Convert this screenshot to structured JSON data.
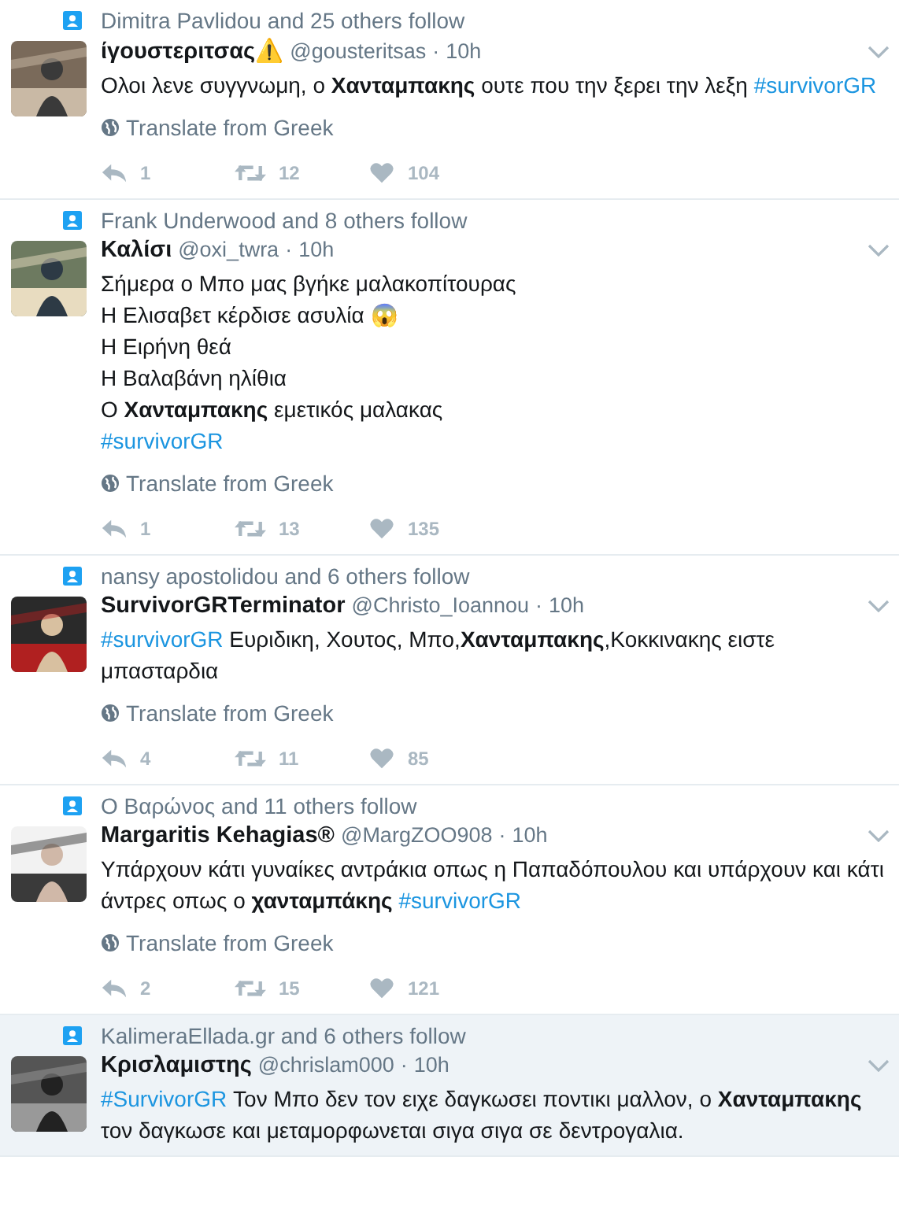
{
  "tweets": [
    {
      "social_context": "Dimitra Pavlidou and 25 others follow",
      "name": "ίγουστεριτσας⚠️",
      "handle": "@gousteritsas",
      "separator": "·",
      "time": "10h",
      "highlighted": false,
      "body": [
        {
          "kind": "text",
          "text": "Ολοι λενε συγγνωμη, ο **Χανταμπακης** ουτε που την ξερει την λεξη "
        },
        {
          "kind": "hashtag",
          "text": "#survivorGR"
        }
      ],
      "translate": "Translate from Greek",
      "replies": "1",
      "retweets": "12",
      "likes": "104"
    },
    {
      "social_context": "Frank Underwood and 8 others follow",
      "name": "Καλίσι",
      "handle": "@oxi_twra",
      "separator": "·",
      "time": "10h",
      "highlighted": false,
      "body": [
        {
          "kind": "text",
          "text": "Σήμερα ο Μπο μας βγήκε μαλακοπίτουρας\nΗ Ελισαβετ κέρδισε ασυλία 😱\nΗ Ειρήνη θεά\nΗ Βαλαβάνη ηλίθια\nΟ **Χανταμπακης** εμετικός μαλακας\n "
        },
        {
          "kind": "hashtag",
          "text": "#survivorGR"
        }
      ],
      "translate": "Translate from Greek",
      "replies": "1",
      "retweets": "13",
      "likes": "135"
    },
    {
      "social_context": "nansy apostolidou and 6 others follow",
      "name": "SurvivorGRTerminator",
      "handle": "@Christo_Ioannou",
      "separator": "·",
      "time": "10h",
      "highlighted": false,
      "body": [
        {
          "kind": "hashtag",
          "text": "#survivorGR"
        },
        {
          "kind": "text",
          "text": " Ευριδικη, Χουτος, Μπο,**Χανταμπακης**,Κοκκινακης ειστε μπασταρδια"
        }
      ],
      "translate": "Translate from Greek",
      "replies": "4",
      "retweets": "11",
      "likes": "85"
    },
    {
      "social_context": "Ο Βαρώνος and 11 others follow",
      "name": "Margaritis Kehagias®",
      "handle": "@MargZOO908",
      "separator": "·",
      "time": "10h",
      "highlighted": false,
      "body": [
        {
          "kind": "text",
          "text": "Υπάρχουν κάτι γυναίκες αντράκια οπως η Παπαδόπουλου και υπάρχουν και κάτι άντρες οπως ο **χανταμπάκης** "
        },
        {
          "kind": "hashtag",
          "text": "#survivorGR"
        }
      ],
      "translate": "Translate from Greek",
      "replies": "2",
      "retweets": "15",
      "likes": "121"
    },
    {
      "social_context": "KalimeraEllada.gr and 6 others follow",
      "name": "Κρισλαμιστης",
      "handle": "@chrislam000",
      "separator": "·",
      "time": "10h",
      "highlighted": true,
      "body": [
        {
          "kind": "hashtag",
          "text": "#SurvivorGR"
        },
        {
          "kind": "text",
          "text": " Τον Μπο δεν τον ειχε δαγκωσει ποντικι μαλλον, ο **Χανταμπακης** τον δαγκωσε και μεταμορφωνεται σιγα σιγα σε δεντρογαλια."
        }
      ]
    }
  ]
}
